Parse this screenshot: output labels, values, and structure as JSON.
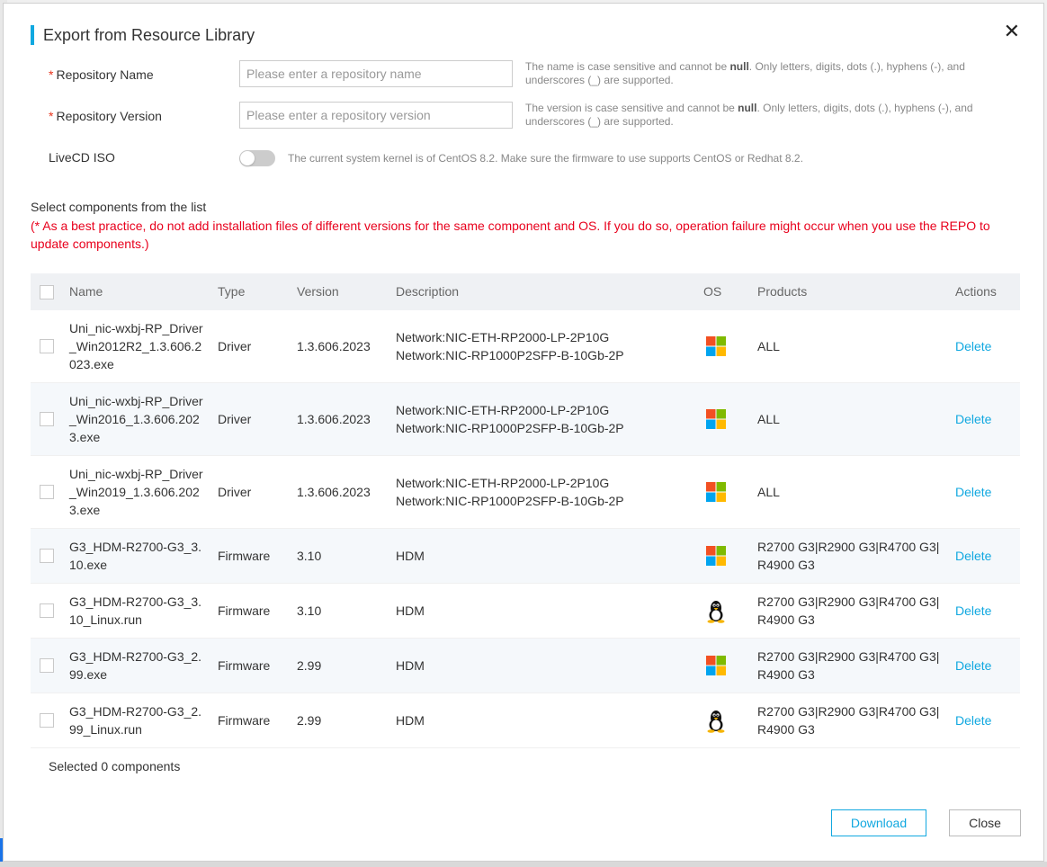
{
  "dialog": {
    "title": "Export from Resource Library",
    "close_glyph": "✕"
  },
  "form": {
    "repo_name": {
      "required_mark": "*",
      "label": "Repository Name",
      "placeholder": "Please enter a repository name",
      "value": "",
      "hint_pre": "The name is case sensitive and cannot be ",
      "hint_bold": "null",
      "hint_post": ". Only letters, digits, dots (.), hyphens (-), and underscores (_) are supported."
    },
    "repo_version": {
      "required_mark": "*",
      "label": "Repository Version",
      "placeholder": "Please enter a repository version",
      "value": "",
      "hint_pre": "The version is case sensitive and cannot be ",
      "hint_bold": "null",
      "hint_post": ". Only letters, digits, dots (.), hyphens (-), and underscores (_) are supported."
    },
    "livecd": {
      "label": "LiveCD ISO",
      "enabled": false,
      "hint": "The current system kernel is of CentOS 8.2. Make sure the firmware to use supports CentOS or Redhat 8.2."
    }
  },
  "components": {
    "heading": "Select components from the list",
    "warning": "(* As a best practice, do not add installation files of different versions for the same component and OS. If you do so, operation failure might occur when you use the REPO to update components.)",
    "columns": {
      "name": "Name",
      "type": "Type",
      "version": "Version",
      "description": "Description",
      "os": "OS",
      "products": "Products",
      "actions": "Actions"
    },
    "rows": [
      {
        "name": "Uni_nic-wxbj-RP_Driver_Win2012R2_1.3.606.2023.exe",
        "type": "Driver",
        "version": "1.3.606.2023",
        "description": [
          "Network:NIC-ETH-RP2000-LP-2P10G",
          "Network:NIC-RP1000P2SFP-B-10Gb-2P"
        ],
        "os": "windows-icon",
        "products": "ALL",
        "action": "Delete"
      },
      {
        "name": "Uni_nic-wxbj-RP_Driver_Win2016_1.3.606.2023.exe",
        "type": "Driver",
        "version": "1.3.606.2023",
        "description": [
          "Network:NIC-ETH-RP2000-LP-2P10G",
          "Network:NIC-RP1000P2SFP-B-10Gb-2P"
        ],
        "os": "windows-icon",
        "products": "ALL",
        "action": "Delete"
      },
      {
        "name": "Uni_nic-wxbj-RP_Driver_Win2019_1.3.606.2023.exe",
        "type": "Driver",
        "version": "1.3.606.2023",
        "description": [
          "Network:NIC-ETH-RP2000-LP-2P10G",
          "Network:NIC-RP1000P2SFP-B-10Gb-2P"
        ],
        "os": "windows-icon",
        "products": "ALL",
        "action": "Delete"
      },
      {
        "name": "G3_HDM-R2700-G3_3.10.exe",
        "type": "Firmware",
        "version": "3.10",
        "description": [
          "HDM"
        ],
        "os": "windows-icon",
        "products": "R2700 G3|R2900 G3|R4700 G3|R4900 G3",
        "action": "Delete"
      },
      {
        "name": "G3_HDM-R2700-G3_3.10_Linux.run",
        "type": "Firmware",
        "version": "3.10",
        "description": [
          "HDM"
        ],
        "os": "linux-icon",
        "products": "R2700 G3|R2900 G3|R4700 G3|R4900 G3",
        "action": "Delete"
      },
      {
        "name": "G3_HDM-R2700-G3_2.99.exe",
        "type": "Firmware",
        "version": "2.99",
        "description": [
          "HDM"
        ],
        "os": "windows-icon",
        "products": "R2700 G3|R2900 G3|R4700 G3|R4900 G3",
        "action": "Delete"
      },
      {
        "name": "G3_HDM-R2700-G3_2.99_Linux.run",
        "type": "Firmware",
        "version": "2.99",
        "description": [
          "HDM"
        ],
        "os": "linux-icon",
        "products": "R2700 G3|R2900 G3|R4700 G3|R4900 G3",
        "action": "Delete"
      }
    ],
    "selected_text": "Selected 0 components"
  },
  "footer": {
    "download_label": "Download",
    "close_label": "Close"
  },
  "colors": {
    "accent": "#11a8e0",
    "warning": "#e8001c",
    "required": "#e8341c"
  }
}
